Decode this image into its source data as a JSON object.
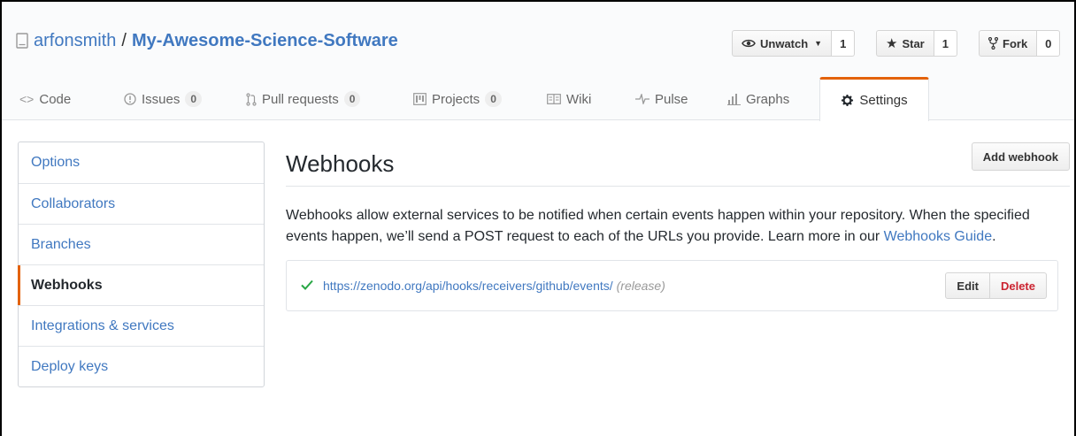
{
  "repo": {
    "owner": "arfonsmith",
    "separator": "/",
    "name": "My-Awesome-Science-Software"
  },
  "actions": {
    "watch": {
      "label": "Unwatch",
      "count": "1"
    },
    "star": {
      "label": "Star",
      "count": "1"
    },
    "fork": {
      "label": "Fork",
      "count": "0"
    }
  },
  "tabs": [
    {
      "label": "Code",
      "icon": "code-icon"
    },
    {
      "label": "Issues",
      "icon": "issue-icon",
      "counter": "0"
    },
    {
      "label": "Pull requests",
      "icon": "pull-request-icon",
      "counter": "0"
    },
    {
      "label": "Projects",
      "icon": "project-icon",
      "counter": "0"
    },
    {
      "label": "Wiki",
      "icon": "book-icon"
    },
    {
      "label": "Pulse",
      "icon": "pulse-icon"
    },
    {
      "label": "Graphs",
      "icon": "graph-icon"
    },
    {
      "label": "Settings",
      "icon": "gear-icon",
      "selected": true
    }
  ],
  "sidebar": {
    "items": [
      {
        "label": "Options"
      },
      {
        "label": "Collaborators"
      },
      {
        "label": "Branches"
      },
      {
        "label": "Webhooks",
        "selected": true
      },
      {
        "label": "Integrations & services"
      },
      {
        "label": "Deploy keys"
      }
    ]
  },
  "main": {
    "title": "Webhooks",
    "add_button": "Add webhook",
    "description": "Webhooks allow external services to be notified when certain events happen within your repository. When the specified events happen, we’ll send a POST request to each of the URLs you provide. Learn more in our",
    "guide_link": "Webhooks Guide",
    "guide_suffix": ".",
    "hooks": [
      {
        "url": "https://zenodo.org/api/hooks/receivers/github/events/",
        "event": "(release)",
        "status_icon": "check-icon",
        "edit_label": "Edit",
        "delete_label": "Delete"
      }
    ]
  },
  "colors": {
    "link": "#4078c0",
    "accent": "#e36209",
    "success": "#28a745",
    "danger": "#cb2431"
  }
}
